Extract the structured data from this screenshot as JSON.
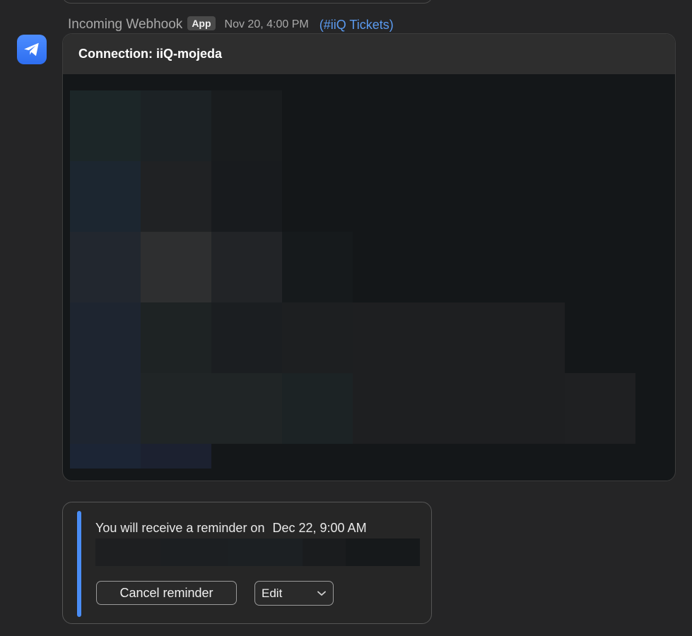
{
  "message": {
    "sender": "Incoming Webhook",
    "badge": "App",
    "timestamp": "Nov 20, 4:00 PM",
    "channel": "(#iiQ Tickets)",
    "avatar_icon": "paper-plane-icon",
    "avatar_color": "#3b7cf6"
  },
  "attachment": {
    "title": "Connection: iiQ-mojeda"
  },
  "reminder": {
    "text": "You will receive a reminder on",
    "date": "Dec 22, 9:00 AM",
    "cancel_label": "Cancel reminder",
    "edit_label": "Edit",
    "edit_icon": "chevron-down-icon",
    "accent_color": "#4a8df5"
  }
}
